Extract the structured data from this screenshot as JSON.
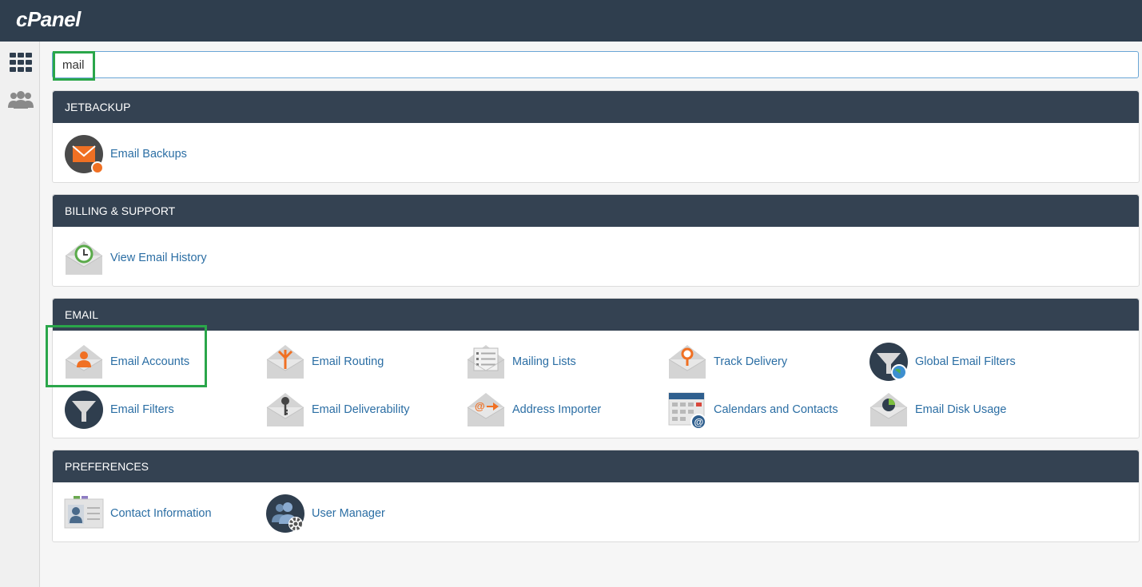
{
  "header": {
    "logo": "cPanel"
  },
  "search": {
    "value": "mail"
  },
  "sections": {
    "jetbackup": {
      "title": "JETBACKUP",
      "items": [
        "Email Backups"
      ]
    },
    "billing": {
      "title": "BILLING & SUPPORT",
      "items": [
        "View Email History"
      ]
    },
    "email": {
      "title": "EMAIL",
      "items": [
        "Email Accounts",
        "Email Routing",
        "Mailing Lists",
        "Track Delivery",
        "Global Email Filters",
        "Email Filters",
        "Email Deliverability",
        "Address Importer",
        "Calendars and Contacts",
        "Email Disk Usage"
      ]
    },
    "preferences": {
      "title": "PREFERENCES",
      "items": [
        "Contact Information",
        "User Manager"
      ]
    }
  },
  "colors": {
    "topbar": "#2f3e4e",
    "section_header": "#344252",
    "link": "#2b6ea4",
    "highlight": "#2aa64a",
    "accent_orange": "#f07023"
  }
}
